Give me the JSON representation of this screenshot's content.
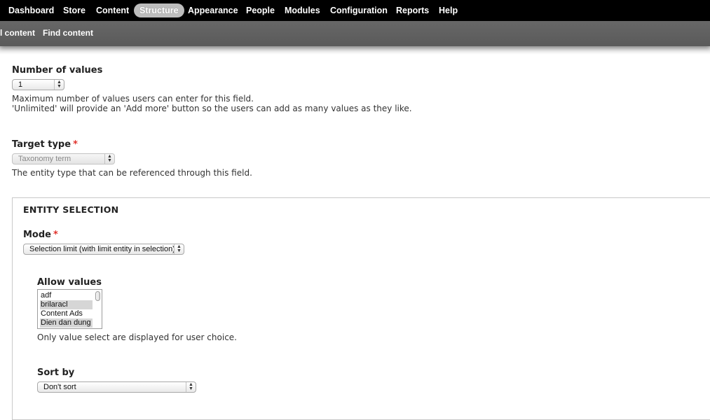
{
  "toolbar": {
    "items": [
      "Dashboard",
      "Store",
      "Content",
      "Structure",
      "Appearance",
      "People",
      "Modules",
      "Configuration",
      "Reports",
      "Help"
    ],
    "active": "Structure"
  },
  "shortcuts": {
    "items": [
      "l content",
      "Find content"
    ]
  },
  "number_of_values": {
    "label": "Number of values",
    "value": "1",
    "desc_line1": "Maximum number of values users can enter for this field.",
    "desc_line2": "'Unlimited' will provide an 'Add more' button so the users can add as many values as they like."
  },
  "target_type": {
    "label": "Target type",
    "required_mark": "*",
    "value": "Taxonomy term",
    "desc": "The entity type that can be referenced through this field."
  },
  "entity_selection": {
    "legend": "ENTITY SELECTION",
    "mode": {
      "label": "Mode",
      "required_mark": "*",
      "value": "Selection limit (with limit entity in selection)"
    },
    "allow_values": {
      "label": "Allow values",
      "options": [
        "adf",
        "brilaracl",
        "Content Ads",
        "Dien dan dung"
      ],
      "selected": [
        "brilaracl",
        "Dien dan dung"
      ],
      "desc": "Only value select are displayed for user choice."
    },
    "sort_by": {
      "label": "Sort by",
      "value": "Don't sort"
    }
  },
  "colors": {
    "toolbar_bg": "#000000",
    "shortcuts_bg": "#5f5f5f",
    "required": "#e0312b",
    "active_pill": "#bdbdbd"
  }
}
